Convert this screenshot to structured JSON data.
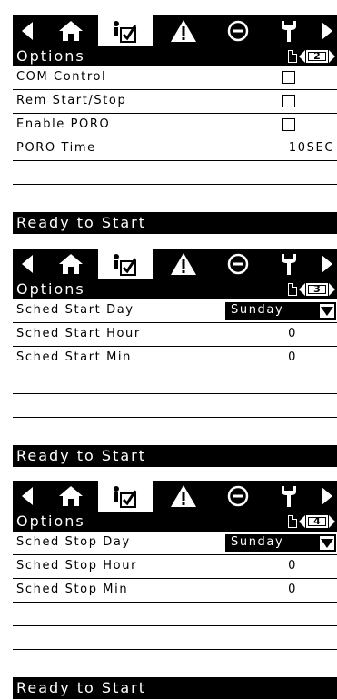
{
  "tabs": {
    "icons": [
      "left-arrow-icon",
      "home-icon",
      "options-checklist-icon",
      "warning-icon",
      "stop-icon",
      "service-wrench-icon",
      "right-arrow-icon"
    ],
    "active": "options-checklist-icon"
  },
  "screens": [
    {
      "title": "Options",
      "page": "2",
      "rows": [
        {
          "label": "COM Control",
          "type": "checkbox",
          "checked": false
        },
        {
          "label": "Rem Start/Stop",
          "type": "checkbox",
          "checked": false
        },
        {
          "label": "Enable PORO",
          "type": "checkbox",
          "checked": false
        },
        {
          "label": "PORO Time",
          "type": "text",
          "value": "10SEC"
        }
      ],
      "status": "Ready to Start"
    },
    {
      "title": "Options",
      "page": "3",
      "rows": [
        {
          "label": "Sched Start Day",
          "type": "select",
          "value": "Sunday"
        },
        {
          "label": "Sched Start Hour",
          "type": "text",
          "value": "0"
        },
        {
          "label": "Sched Start Min",
          "type": "text",
          "value": "0"
        }
      ],
      "status": "Ready to Start"
    },
    {
      "title": "Options",
      "page": "4",
      "rows": [
        {
          "label": "Sched Stop Day",
          "type": "select",
          "value": "Sunday"
        },
        {
          "label": "Sched Stop Hour",
          "type": "text",
          "value": "0"
        },
        {
          "label": "Sched Stop Min",
          "type": "text",
          "value": "0"
        }
      ],
      "status": "Ready to Start"
    }
  ]
}
